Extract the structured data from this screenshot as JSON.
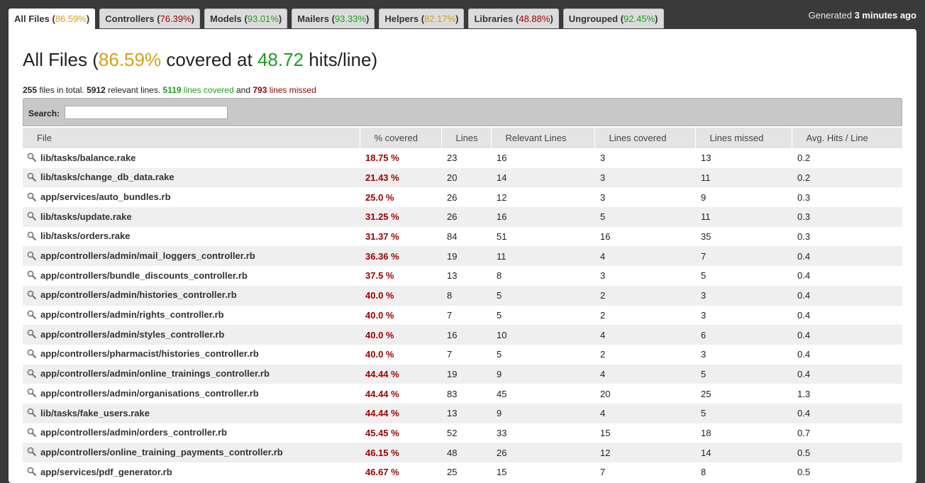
{
  "tabs": [
    {
      "label": "All Files",
      "pct": "86.59%",
      "color": "yellow",
      "active": true
    },
    {
      "label": "Controllers",
      "pct": "76.39%",
      "color": "red",
      "active": false
    },
    {
      "label": "Models",
      "pct": "93.01%",
      "color": "green",
      "active": false
    },
    {
      "label": "Mailers",
      "pct": "93.33%",
      "color": "green",
      "active": false
    },
    {
      "label": "Helpers",
      "pct": "82.17%",
      "color": "yellow",
      "active": false
    },
    {
      "label": "Libraries",
      "pct": "48.88%",
      "color": "red",
      "active": false
    },
    {
      "label": "Ungrouped",
      "pct": "92.45%",
      "color": "green",
      "active": false
    }
  ],
  "generated": {
    "prefix": "Generated",
    "value": "3 minutes ago"
  },
  "header": {
    "name": "All Files",
    "percent": "86.59%",
    "middle": "covered at",
    "hits": "48.72",
    "suffix": "hits/line"
  },
  "summary": {
    "files": "255",
    "files_text": "files in total.",
    "relevant": "5912",
    "relevant_text": "relevant lines.",
    "covered": "5119",
    "covered_text": "lines covered",
    "and_text": "and",
    "missed": "793",
    "missed_text": "lines missed"
  },
  "search": {
    "label": "Search:",
    "value": ""
  },
  "columns": [
    "File",
    "% covered",
    "Lines",
    "Relevant Lines",
    "Lines covered",
    "Lines missed",
    "Avg. Hits / Line"
  ],
  "rows": [
    [
      "lib/tasks/balance.rake",
      "18.75 %",
      "23",
      "16",
      "3",
      "13",
      "0.2"
    ],
    [
      "lib/tasks/change_db_data.rake",
      "21.43 %",
      "20",
      "14",
      "3",
      "11",
      "0.2"
    ],
    [
      "app/services/auto_bundles.rb",
      "25.0 %",
      "26",
      "12",
      "3",
      "9",
      "0.3"
    ],
    [
      "lib/tasks/update.rake",
      "31.25 %",
      "26",
      "16",
      "5",
      "11",
      "0.3"
    ],
    [
      "lib/tasks/orders.rake",
      "31.37 %",
      "84",
      "51",
      "16",
      "35",
      "0.3"
    ],
    [
      "app/controllers/admin/mail_loggers_controller.rb",
      "36.36 %",
      "19",
      "11",
      "4",
      "7",
      "0.4"
    ],
    [
      "app/controllers/bundle_discounts_controller.rb",
      "37.5 %",
      "13",
      "8",
      "3",
      "5",
      "0.4"
    ],
    [
      "app/controllers/admin/histories_controller.rb",
      "40.0 %",
      "8",
      "5",
      "2",
      "3",
      "0.4"
    ],
    [
      "app/controllers/admin/rights_controller.rb",
      "40.0 %",
      "7",
      "5",
      "2",
      "3",
      "0.4"
    ],
    [
      "app/controllers/admin/styles_controller.rb",
      "40.0 %",
      "16",
      "10",
      "4",
      "6",
      "0.4"
    ],
    [
      "app/controllers/pharmacist/histories_controller.rb",
      "40.0 %",
      "7",
      "5",
      "2",
      "3",
      "0.4"
    ],
    [
      "app/controllers/admin/online_trainings_controller.rb",
      "44.44 %",
      "19",
      "9",
      "4",
      "5",
      "0.4"
    ],
    [
      "app/controllers/admin/organisations_controller.rb",
      "44.44 %",
      "83",
      "45",
      "20",
      "25",
      "1.3"
    ],
    [
      "lib/tasks/fake_users.rake",
      "44.44 %",
      "13",
      "9",
      "4",
      "5",
      "0.4"
    ],
    [
      "app/controllers/admin/orders_controller.rb",
      "45.45 %",
      "52",
      "33",
      "15",
      "18",
      "0.7"
    ],
    [
      "app/controllers/online_training_payments_controller.rb",
      "46.15 %",
      "48",
      "26",
      "12",
      "14",
      "0.5"
    ],
    [
      "app/services/pdf_generator.rb",
      "46.67 %",
      "25",
      "15",
      "7",
      "8",
      "0.5"
    ]
  ],
  "colors": {
    "yellow": "#d4a017",
    "green": "#1e9e1e",
    "red": "#a00000"
  }
}
